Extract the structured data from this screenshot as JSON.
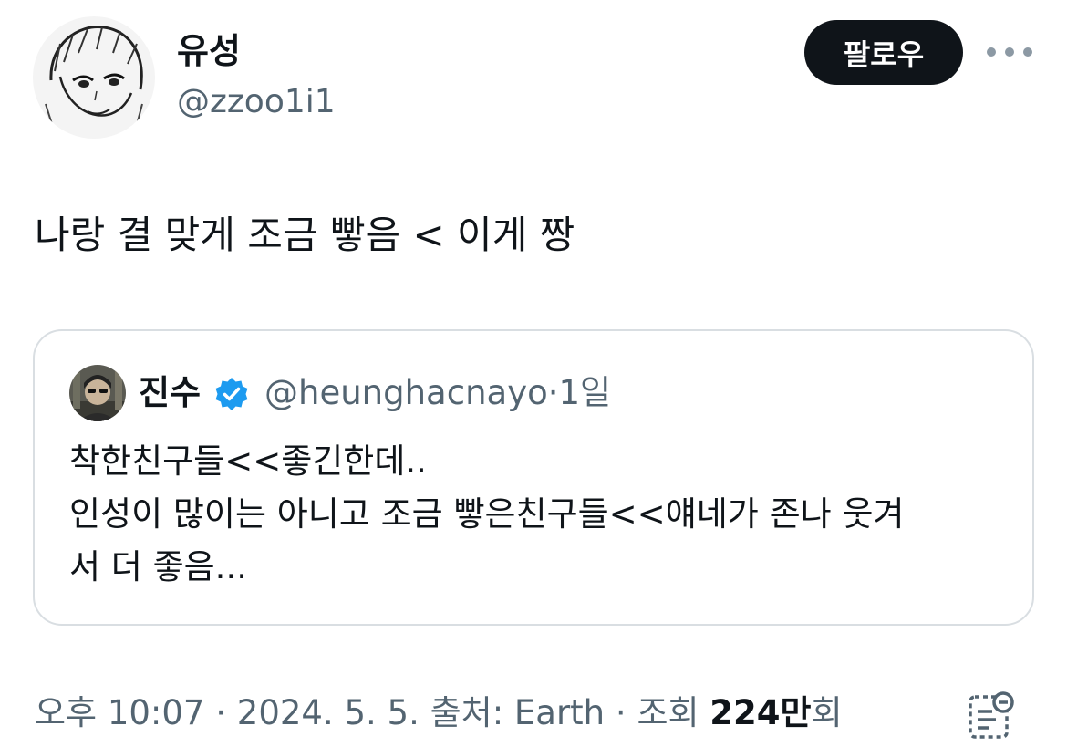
{
  "author": {
    "display_name": "유성",
    "handle": "@zzoo1i1"
  },
  "actions": {
    "follow_label": "팔로우",
    "more_icon": "more-horizontal-icon"
  },
  "tweet": {
    "text": "나랑 결 맞게 조금 빻음 < 이게 짱"
  },
  "quoted_tweet": {
    "display_name": "진수",
    "verified_icon": "verified-badge-icon",
    "handle": "@heunghacnayo",
    "separator": "·",
    "time_ago": "1일",
    "lines": [
      "착한친구들<<좋긴한데..",
      "인성이 많이는 아니고 조금 빻은친구들<<얘네가 존나 웃겨",
      "서 더 좋음..."
    ]
  },
  "footer": {
    "time": "오후 10:07",
    "date": "2024. 5. 5.",
    "source": "출처: Earth",
    "views_label": "조회",
    "views_count": "224만",
    "views_suffix": "회",
    "separator": " · ",
    "analytics_icon": "analytics-icon"
  },
  "colors": {
    "text_primary": "#0f1419",
    "text_secondary": "#536471",
    "follow_bg": "#0f1419",
    "verified": "#1d9bf0",
    "border": "#d9dee2"
  }
}
